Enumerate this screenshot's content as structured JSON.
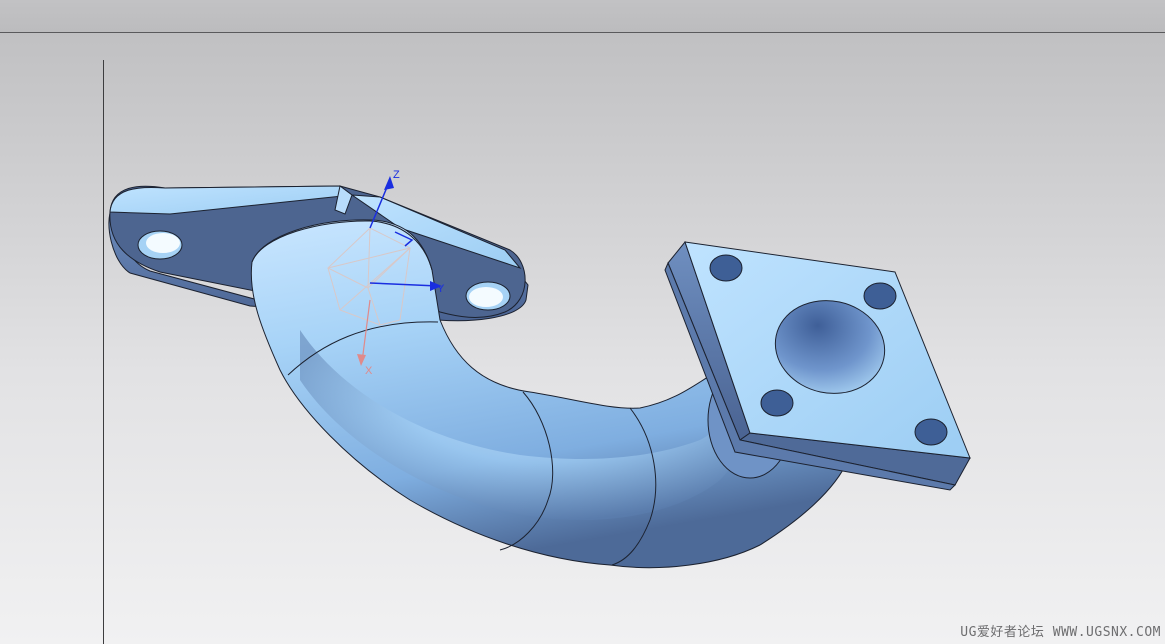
{
  "viewport": {
    "background_colors": [
      "#bdbdbf",
      "#f1f1f2"
    ],
    "model": {
      "name": "exhaust-pipe-elbow",
      "body_color": "#9fd0f4",
      "shadow_color": "#4f6690",
      "edge_color": "#1c2230"
    },
    "triad": {
      "z_label": "Z",
      "y_label": "Y",
      "x_label": "X",
      "z_color": "#1a2ee0",
      "y_color": "#1a2ee0",
      "x_color": "#e08a8a"
    }
  },
  "watermark": {
    "text": "UG爱好者论坛 WWW.UGSNX.COM"
  }
}
